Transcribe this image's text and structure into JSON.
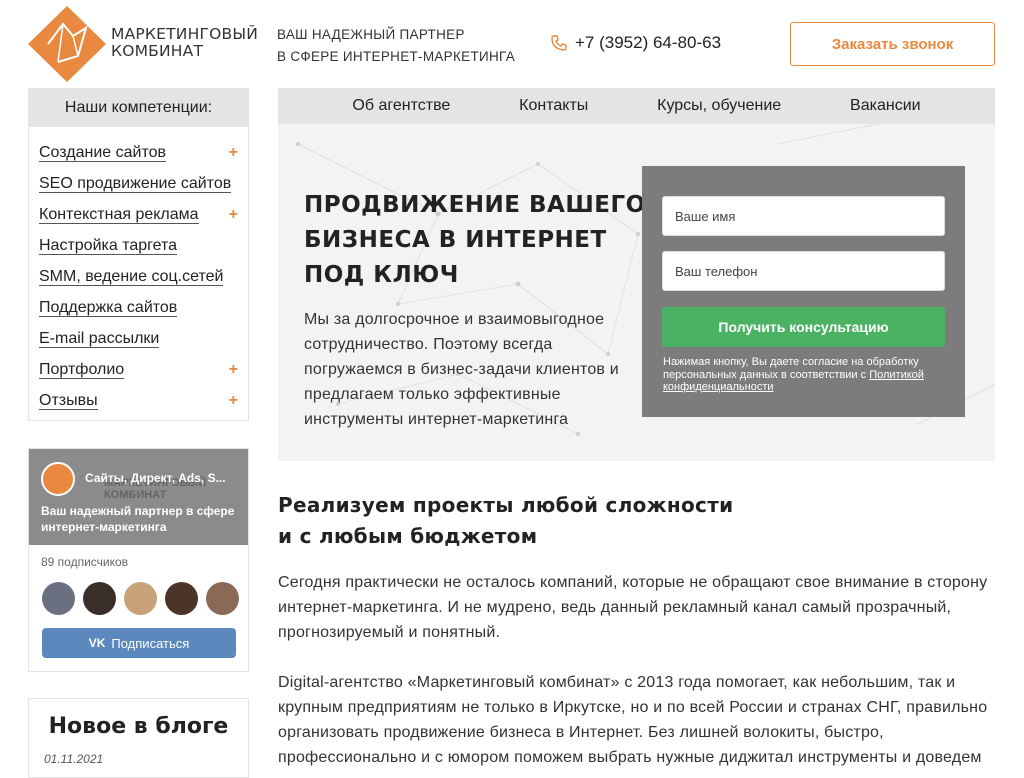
{
  "header": {
    "logo_line1": "МАРКЕТИНГОВЫЙ",
    "logo_line2": "КОМБИНАТ",
    "tagline_line1": "ВАШ НАДЕЖНЫЙ ПАРТНЕР",
    "tagline_line2": "В СФЕРЕ ИНТЕРНЕТ-МАРКЕТИНГА",
    "phone": "+7 (3952) 64-80-63",
    "call_button": "Заказать звонок"
  },
  "sidebar": {
    "title": "Наши компетенции:",
    "items": [
      {
        "label": "Создание сайтов",
        "expandable": "+"
      },
      {
        "label": "SEO продвижение сайтов",
        "expandable": ""
      },
      {
        "label": "Контекстная реклама",
        "expandable": "+"
      },
      {
        "label": "Настройка таргета",
        "expandable": ""
      },
      {
        "label": "SMM, ведение соц.сетей",
        "expandable": ""
      },
      {
        "label": "Поддержка сайтов",
        "expandable": ""
      },
      {
        "label": "E-mail рассылки",
        "expandable": ""
      },
      {
        "label": "Портфолио",
        "expandable": "+"
      },
      {
        "label": "Отзывы",
        "expandable": "+"
      }
    ]
  },
  "nav": {
    "items": [
      "Об агентстве",
      "Контакты",
      "Курсы, обучение",
      "Вакансии"
    ]
  },
  "hero": {
    "title": "ПРОДВИЖЕНИЕ ВАШЕГО БИЗНЕСА В ИНТЕРНЕТ ПОД КЛЮЧ",
    "text": "Мы за долгосрочное и взаимовыгодное сотрудничество. Поэтому всегда погружаемся в бизнес-задачи клиентов и предлагаем только эффективные инструменты интернет-маркетинга"
  },
  "form": {
    "name_placeholder": "Ваше имя",
    "phone_placeholder": "Ваш телефон",
    "submit": "Получить консультацию",
    "consent_text": "Нажимая кнопку, Вы даете согласие на обработку персональных данных в соответствии с ",
    "consent_link": "Политикой конфиденциальности"
  },
  "vk_widget": {
    "group_name": "Сайты, Директ, Ads, S...",
    "banner_text": "МАРКЕТИНГОВЫЙ КОМБИНАТ",
    "description": "Ваш надежный партнер в сфере интернет-маркетинга",
    "subscribers": "89 подписчиков",
    "subscribe_button": "Подписаться",
    "vk_logo": "VK"
  },
  "blog": {
    "title": "Новое в блоге",
    "date": "01.11.2021"
  },
  "main": {
    "heading_line1": "Реализуем проекты любой сложности",
    "heading_line2": "и с любым бюджетом",
    "paragraph1": "Сегодня практически не осталось компаний, которые не обращают свое внимание в сторону интернет-маркетинга. И не мудрено, ведь данный рекламный канал самый прозрачный, прогнозируемый и понятный.",
    "paragraph2": "Digital-агентство «Маркетинговый комбинат» с 2013 года помогает, как небольшим, так и крупным предприятиям не только в Иркутске, но и по всей России и странах СНГ, правильно организовать продвижение бизнеса в Интернет. Без лишней волокиты, быстро, профессионально и с юмором поможем выбрать нужные диджитал инструменты и доведем"
  },
  "colors": {
    "accent": "#e8893f",
    "green": "#4bb264",
    "vk_blue": "#5b88bd"
  }
}
